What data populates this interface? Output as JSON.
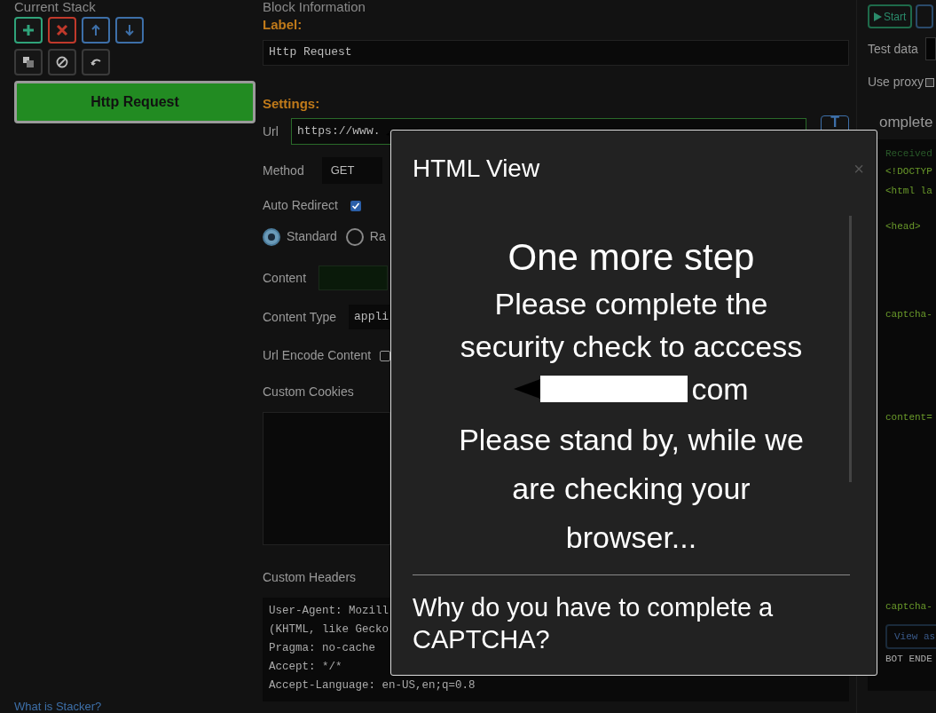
{
  "stack": {
    "title": "Current Stack",
    "tools": [
      {
        "kind": "add",
        "color": "#2fa37a"
      },
      {
        "kind": "remove",
        "color": "#c0392b"
      },
      {
        "kind": "up",
        "color": "#3d6fa8"
      },
      {
        "kind": "down",
        "color": "#3d6fa8"
      },
      {
        "kind": "clone",
        "color": "#3a3a3a"
      },
      {
        "kind": "disable",
        "color": "#3a3a3a"
      },
      {
        "kind": "undo",
        "color": "#3a3a3a"
      }
    ],
    "blocks": [
      {
        "label": "Http Request",
        "selected": true
      }
    ],
    "help_link": "What is Stacker?"
  },
  "block": {
    "title": "Block Information",
    "label_heading": "Label:",
    "label_value": "Http Request",
    "settings_heading": "Settings:",
    "url": {
      "label": "Url",
      "value": "https://www.",
      "button": "T"
    },
    "method": {
      "label": "Method",
      "value": "GET"
    },
    "auto_redirect": {
      "label": "Auto Redirect",
      "checked": true
    },
    "mode": [
      {
        "label": "Standard",
        "selected": true
      },
      {
        "label": "Ra",
        "selected": false
      }
    ],
    "content": {
      "label": "Content"
    },
    "content_type": {
      "label": "Content Type",
      "value": "appli"
    },
    "url_encode": {
      "label": "Url Encode Content",
      "checked": false
    },
    "cookies": {
      "label": "Custom Cookies"
    },
    "headers": {
      "label": "Custom Headers",
      "lines": [
        "User-Agent: Mozill",
        "(KHTML, like Gecko",
        "Pragma: no-cache",
        "Accept: */*",
        "Accept-Language: en-US,en;q=0.8"
      ]
    }
  },
  "debugger": {
    "start": "Start",
    "test_data": "Test data",
    "use_proxy": {
      "label": "Use proxy",
      "checked": false
    },
    "log_title": "omplete",
    "log": [
      {
        "text": "Received",
        "kind": "dim"
      },
      {
        "text": "<!DOCTYP",
        "kind": "code"
      },
      {
        "text": "<html la",
        "kind": "code"
      },
      {
        "text": "<head>",
        "kind": "code"
      },
      {
        "text": "captcha-",
        "kind": "code"
      },
      {
        "text": "content=",
        "kind": "code"
      },
      {
        "text": "captcha-",
        "kind": "code"
      }
    ],
    "view_button": "View as",
    "end_text": "BOT ENDE"
  },
  "modal": {
    "title": "HTML View",
    "close": "×",
    "heading": "One more step",
    "line_1": "Please complete the security check to acccess",
    "line_2": "com",
    "line_3": "Please stand by, while we are checking your browser...",
    "question": "Why do you have to complete a CAPTCHA?"
  }
}
